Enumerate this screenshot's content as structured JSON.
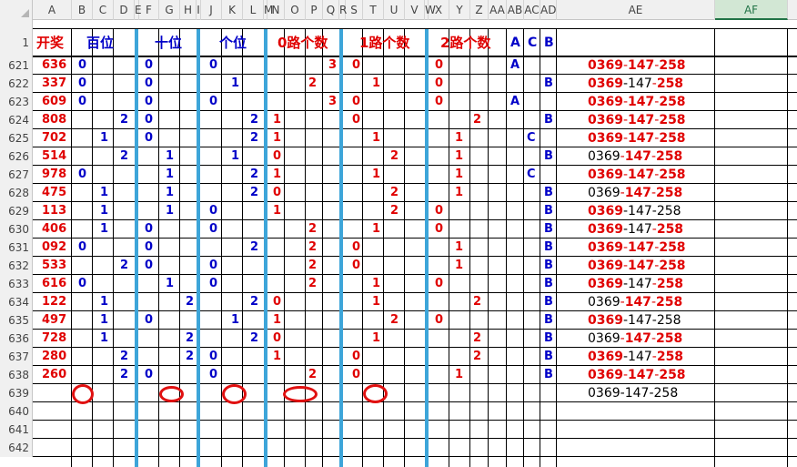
{
  "columns": [
    "A",
    "B",
    "C",
    "D",
    "E",
    "F",
    "G",
    "H",
    "I",
    "J",
    "K",
    "L",
    "M",
    "N",
    "O",
    "P",
    "Q",
    "R",
    "S",
    "T",
    "U",
    "V",
    "W",
    "X",
    "Y",
    "Z",
    "AA",
    "AB",
    "AC",
    "AD",
    "AE",
    "AF"
  ],
  "selected_column": "AF",
  "header_row": {
    "row_number": "1",
    "titles": {
      "kaijiang": "开奖",
      "baiwei": "百位",
      "shiwei": "十位",
      "gewei": "个位",
      "route0": "0路个数",
      "route1": "1路个数",
      "route2": "2路个数",
      "ab": "A",
      "ac": "C",
      "ad": "B"
    }
  },
  "rows": [
    {
      "n": "621",
      "draw": "636",
      "b": [
        "0",
        "",
        ""
      ],
      "s": [
        "0",
        "",
        ""
      ],
      "g": [
        "0",
        "",
        ""
      ],
      "r0": [
        "",
        "",
        "3"
      ],
      "r1": [
        "0",
        "",
        ""
      ],
      "r2": [
        "0",
        "",
        ""
      ],
      "abc": [
        "A",
        "",
        ""
      ],
      "ae": "0369-147-258",
      "hl": "a"
    },
    {
      "n": "622",
      "draw": "337",
      "b": [
        "0",
        "",
        ""
      ],
      "s": [
        "0",
        "",
        ""
      ],
      "g": [
        "",
        "1",
        ""
      ],
      "r0": [
        "",
        "2",
        ""
      ],
      "r1": [
        "",
        "1",
        ""
      ],
      "r2": [
        "0",
        "",
        ""
      ],
      "abc": [
        "",
        "",
        "B"
      ],
      "ae": "0369-147-258",
      "hl": "b"
    },
    {
      "n": "623",
      "draw": "609",
      "b": [
        "0",
        "",
        ""
      ],
      "s": [
        "0",
        "",
        ""
      ],
      "g": [
        "0",
        "",
        ""
      ],
      "r0": [
        "",
        "",
        "3"
      ],
      "r1": [
        "0",
        "",
        ""
      ],
      "r2": [
        "0",
        "",
        ""
      ],
      "abc": [
        "A",
        "",
        ""
      ],
      "ae": "0369-147-258",
      "hl": "a"
    },
    {
      "n": "624",
      "draw": "808",
      "b": [
        "",
        "",
        "2"
      ],
      "s": [
        "0",
        "",
        ""
      ],
      "g": [
        "",
        "",
        "2"
      ],
      "r0": [
        "1",
        "",
        ""
      ],
      "r1": [
        "0",
        "",
        ""
      ],
      "r2": [
        "",
        "",
        "2"
      ],
      "abc": [
        "",
        "",
        "B"
      ],
      "ae": "0369-147-258",
      "hl": "c"
    },
    {
      "n": "625",
      "draw": "702",
      "b": [
        "",
        "1",
        ""
      ],
      "s": [
        "0",
        "",
        ""
      ],
      "g": [
        "",
        "",
        "2"
      ],
      "r0": [
        "1",
        "",
        ""
      ],
      "r1": [
        "",
        "1",
        ""
      ],
      "r2": [
        "",
        "1",
        ""
      ],
      "abc": [
        "",
        "C",
        ""
      ],
      "ae": "0369-147-258",
      "hl": "c"
    },
    {
      "n": "626",
      "draw": "514",
      "b": [
        "",
        "",
        "2"
      ],
      "s": [
        "",
        "1",
        ""
      ],
      "g": [
        "",
        "1",
        ""
      ],
      "r0": [
        "0",
        "",
        ""
      ],
      "r1": [
        "",
        "",
        "2"
      ],
      "r2": [
        "",
        "1",
        ""
      ],
      "abc": [
        "",
        "",
        "B"
      ],
      "ae": "0369-147-258",
      "hl": "d"
    },
    {
      "n": "627",
      "draw": "978",
      "b": [
        "0",
        "",
        ""
      ],
      "s": [
        "",
        "1",
        ""
      ],
      "g": [
        "",
        "",
        "2"
      ],
      "r0": [
        "1",
        "",
        ""
      ],
      "r1": [
        "",
        "1",
        ""
      ],
      "r2": [
        "",
        "1",
        ""
      ],
      "abc": [
        "",
        "C",
        ""
      ],
      "ae": "0369-147-258",
      "hl": "c"
    },
    {
      "n": "628",
      "draw": "475",
      "b": [
        "",
        "1",
        ""
      ],
      "s": [
        "",
        "1",
        ""
      ],
      "g": [
        "",
        "",
        "2"
      ],
      "r0": [
        "0",
        "",
        ""
      ],
      "r1": [
        "",
        "",
        "2"
      ],
      "r2": [
        "",
        "1",
        ""
      ],
      "abc": [
        "",
        "",
        "B"
      ],
      "ae": "0369-147-258",
      "hl": "d"
    },
    {
      "n": "629",
      "draw": "113",
      "b": [
        "",
        "1",
        ""
      ],
      "s": [
        "",
        "1",
        ""
      ],
      "g": [
        "0",
        "",
        ""
      ],
      "r0": [
        "1",
        "",
        ""
      ],
      "r1": [
        "",
        "",
        "2"
      ],
      "r2": [
        "0",
        "",
        ""
      ],
      "abc": [
        "",
        "",
        "B"
      ],
      "ae": "0369-147-258",
      "hl": "e"
    },
    {
      "n": "630",
      "draw": "406",
      "b": [
        "",
        "1",
        ""
      ],
      "s": [
        "0",
        "",
        ""
      ],
      "g": [
        "0",
        "",
        ""
      ],
      "r0": [
        "",
        "2",
        ""
      ],
      "r1": [
        "",
        "1",
        ""
      ],
      "r2": [
        "0",
        "",
        ""
      ],
      "abc": [
        "",
        "",
        "B"
      ],
      "ae": "0369-147-258",
      "hl": "b"
    },
    {
      "n": "631",
      "draw": "092",
      "b": [
        "0",
        "",
        ""
      ],
      "s": [
        "0",
        "",
        ""
      ],
      "g": [
        "",
        "",
        "2"
      ],
      "r0": [
        "",
        "2",
        ""
      ],
      "r1": [
        "0",
        "",
        ""
      ],
      "r2": [
        "",
        "1",
        ""
      ],
      "abc": [
        "",
        "",
        "B"
      ],
      "ae": "0369-147-258",
      "hl": "f"
    },
    {
      "n": "632",
      "draw": "533",
      "b": [
        "",
        "",
        "2"
      ],
      "s": [
        "0",
        "",
        ""
      ],
      "g": [
        "0",
        "",
        ""
      ],
      "r0": [
        "",
        "2",
        ""
      ],
      "r1": [
        "0",
        "",
        ""
      ],
      "r2": [
        "",
        "1",
        ""
      ],
      "abc": [
        "",
        "",
        "B"
      ],
      "ae": "0369-147-258",
      "hl": "f"
    },
    {
      "n": "633",
      "draw": "616",
      "b": [
        "0",
        "",
        ""
      ],
      "s": [
        "",
        "1",
        ""
      ],
      "g": [
        "0",
        "",
        ""
      ],
      "r0": [
        "",
        "2",
        ""
      ],
      "r1": [
        "",
        "1",
        ""
      ],
      "r2": [
        "0",
        "",
        ""
      ],
      "abc": [
        "",
        "",
        "B"
      ],
      "ae": "0369-147-258",
      "hl": "b"
    },
    {
      "n": "634",
      "draw": "122",
      "b": [
        "",
        "1",
        ""
      ],
      "s": [
        "",
        "",
        "2"
      ],
      "g": [
        "",
        "",
        "2"
      ],
      "r0": [
        "0",
        "",
        ""
      ],
      "r1": [
        "",
        "1",
        ""
      ],
      "r2": [
        "",
        "",
        "2"
      ],
      "abc": [
        "",
        "",
        "B"
      ],
      "ae": "0369-147-258",
      "hl": "g"
    },
    {
      "n": "635",
      "draw": "497",
      "b": [
        "",
        "1",
        ""
      ],
      "s": [
        "0",
        "",
        ""
      ],
      "g": [
        "",
        "1",
        ""
      ],
      "r0": [
        "1",
        "",
        ""
      ],
      "r1": [
        "",
        "",
        "2"
      ],
      "r2": [
        "0",
        "",
        ""
      ],
      "abc": [
        "",
        "",
        "B"
      ],
      "ae": "0369-147-258",
      "hl": "e"
    },
    {
      "n": "636",
      "draw": "728",
      "b": [
        "",
        "1",
        ""
      ],
      "s": [
        "",
        "",
        "2"
      ],
      "g": [
        "",
        "",
        "2"
      ],
      "r0": [
        "0",
        "",
        ""
      ],
      "r1": [
        "",
        "1",
        ""
      ],
      "r2": [
        "",
        "",
        "2"
      ],
      "abc": [
        "",
        "",
        "B"
      ],
      "ae": "0369-147-258",
      "hl": "g"
    },
    {
      "n": "637",
      "draw": "280",
      "b": [
        "",
        "",
        "2"
      ],
      "s": [
        "",
        "",
        "2"
      ],
      "g": [
        "0",
        "",
        ""
      ],
      "r0": [
        "1",
        "",
        ""
      ],
      "r1": [
        "0",
        "",
        ""
      ],
      "r2": [
        "",
        "",
        "2"
      ],
      "abc": [
        "",
        "",
        "B"
      ],
      "ae": "0369-147-258",
      "hl": "h"
    },
    {
      "n": "638",
      "draw": "260",
      "b": [
        "",
        "",
        "2"
      ],
      "s": [
        "0",
        "",
        ""
      ],
      "g": [
        "0",
        "",
        ""
      ],
      "r0": [
        "",
        "2",
        ""
      ],
      "r1": [
        "0",
        "",
        ""
      ],
      "r2": [
        "",
        "1",
        ""
      ],
      "abc": [
        "",
        "",
        "B"
      ],
      "ae": "0369-147-258",
      "hl": "f"
    },
    {
      "n": "639",
      "draw": "",
      "b": [
        "",
        "",
        ""
      ],
      "s": [
        "",
        "",
        ""
      ],
      "g": [
        "",
        "",
        ""
      ],
      "r0": [
        "",
        "",
        ""
      ],
      "r1": [
        "",
        "",
        ""
      ],
      "r2": [
        "",
        "",
        ""
      ],
      "abc": [
        "",
        "",
        ""
      ],
      "ae": "0369-147-258",
      "hl": "none"
    },
    {
      "n": "640",
      "draw": "",
      "b": [
        "",
        "",
        ""
      ],
      "s": [
        "",
        "",
        ""
      ],
      "g": [
        "",
        "",
        ""
      ],
      "r0": [
        "",
        "",
        ""
      ],
      "r1": [
        "",
        "",
        ""
      ],
      "r2": [
        "",
        "",
        ""
      ],
      "abc": [
        "",
        "",
        ""
      ],
      "ae": "",
      "hl": "none"
    },
    {
      "n": "641",
      "draw": "",
      "b": [
        "",
        "",
        ""
      ],
      "s": [
        "",
        "",
        ""
      ],
      "g": [
        "",
        "",
        ""
      ],
      "r0": [
        "",
        "",
        ""
      ],
      "r1": [
        "",
        "",
        ""
      ],
      "r2": [
        "",
        "",
        ""
      ],
      "abc": [
        "",
        "",
        ""
      ],
      "ae": "",
      "hl": "none"
    },
    {
      "n": "642",
      "draw": "",
      "b": [
        "",
        "",
        ""
      ],
      "s": [
        "",
        "",
        ""
      ],
      "g": [
        "",
        "",
        ""
      ],
      "r0": [
        "",
        "",
        ""
      ],
      "r1": [
        "",
        "",
        ""
      ],
      "r2": [
        "",
        "",
        ""
      ],
      "abc": [
        "",
        "",
        ""
      ],
      "ae": "",
      "hl": "none"
    }
  ],
  "annotation_color": "#e01010",
  "accent_blue": "#3da5d9",
  "text_red": "#e00000",
  "text_blue": "#0000c8"
}
